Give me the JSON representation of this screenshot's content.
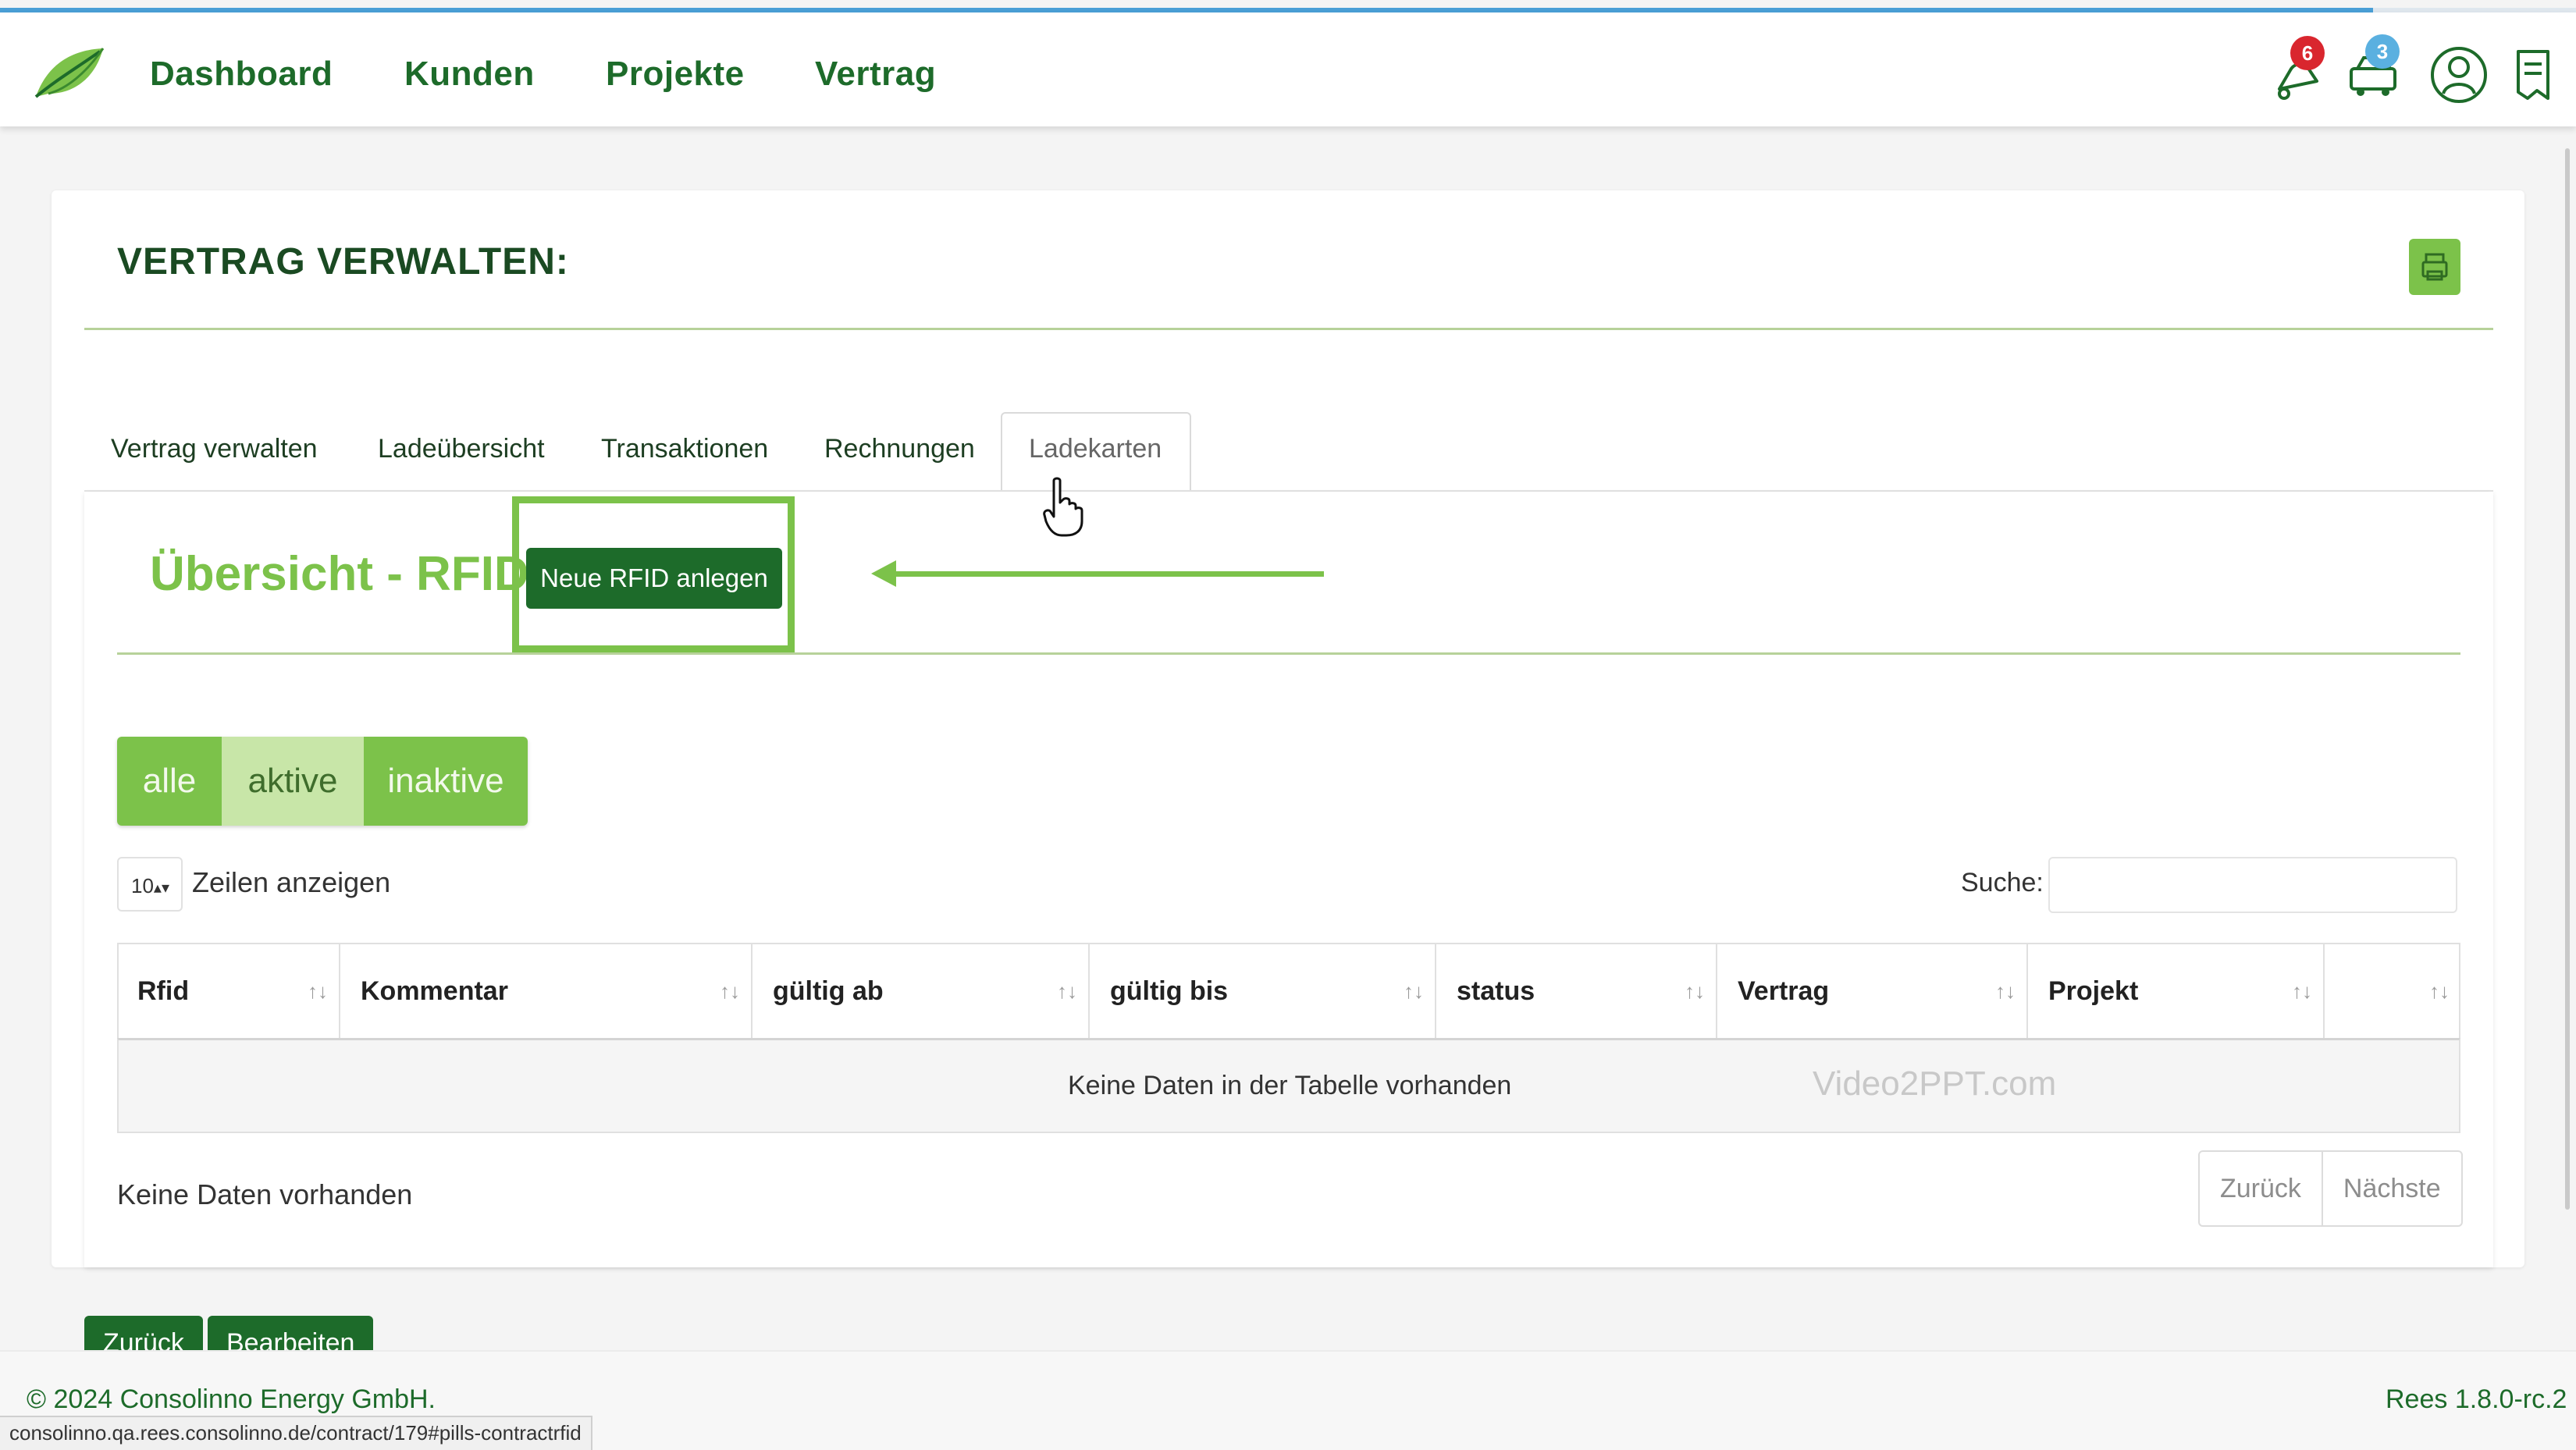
{
  "nav": {
    "items": [
      {
        "label": "Dashboard"
      },
      {
        "label": "Kunden"
      },
      {
        "label": "Projekte"
      },
      {
        "label": "Vertrag"
      }
    ],
    "notifications_badge": "6",
    "tasks_badge": "3"
  },
  "page": {
    "title": "VERTRAG VERWALTEN:",
    "tabs": [
      {
        "label": "Vertrag verwalten"
      },
      {
        "label": "Ladeübersicht"
      },
      {
        "label": "Transaktionen"
      },
      {
        "label": "Rechnungen"
      },
      {
        "label": "Ladekarten"
      }
    ],
    "active_tab": "Ladekarten"
  },
  "section": {
    "title": "Übersicht - RFIDs",
    "new_button": "Neue RFID anlegen"
  },
  "filters": [
    {
      "label": "alle"
    },
    {
      "label": "aktive"
    },
    {
      "label": "inaktive"
    }
  ],
  "table_controls": {
    "page_length": "10",
    "show_label": "Zeilen anzeigen",
    "search_label": "Suche:"
  },
  "table": {
    "columns": [
      "Rfid",
      "Kommentar",
      "gültig ab",
      "gültig bis",
      "status",
      "Vertrag",
      "Projekt",
      ""
    ],
    "empty_message": "Keine Daten in der Tabelle vorhanden",
    "info": "Keine Daten vorhanden"
  },
  "pagination": {
    "prev": "Zurück",
    "next": "Nächste"
  },
  "actions": {
    "back": "Zurück",
    "edit": "Bearbeiten"
  },
  "watermark": "Video2PPT.com",
  "footer": {
    "copyright": "© 2024 Consolinno Energy GmbH.",
    "version": "Rees 1.8.0-rc.2"
  },
  "status_bar": {
    "url": "consolinno.qa.rees.consolinno.de/contract/179#pills-contractrfid"
  },
  "colors": {
    "brand_dark": "#1d6b2a",
    "brand_light": "#7cc24a",
    "filter_active": "#7cc24a",
    "filter_inactive_light": "#c8e6a8",
    "accent_blue": "#4a9fd6",
    "badge_red": "#d9262e",
    "badge_blue": "#5ab0e0"
  },
  "icons": {
    "logo": "leaf-logo-icon",
    "notifications": "bell-icon",
    "tasks": "truck-icon",
    "user": "user-icon",
    "documents": "document-icon",
    "print": "printer-icon",
    "sort": "sort-icon"
  }
}
